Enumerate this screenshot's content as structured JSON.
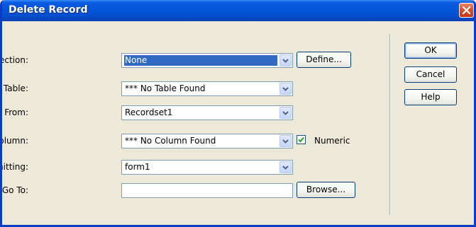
{
  "window": {
    "title": "Delete Record"
  },
  "form": {
    "connection": {
      "label": "Connection:",
      "value": "None"
    },
    "define_button": "Define...",
    "table": {
      "label": "Delete From Table:",
      "value": "*** No Table Found"
    },
    "recordset": {
      "label": "Select Record From:",
      "value": "Recordset1"
    },
    "key_column": {
      "label": "Unique Key Column:",
      "value": "*** No Column Found"
    },
    "numeric": {
      "label": "Numeric",
      "checked": true
    },
    "submitting": {
      "label": "Delete By Submitting:",
      "value": "form1"
    },
    "goto": {
      "label": "After Deleting, Go To:",
      "value": ""
    },
    "browse_button": "Browse..."
  },
  "actions": {
    "ok": "OK",
    "cancel": "Cancel",
    "help": "Help"
  },
  "colors": {
    "titlebar": "#0455d8",
    "selection": "#316ac5",
    "dialog_bg": "#ece9d8",
    "check": "#21a121"
  }
}
